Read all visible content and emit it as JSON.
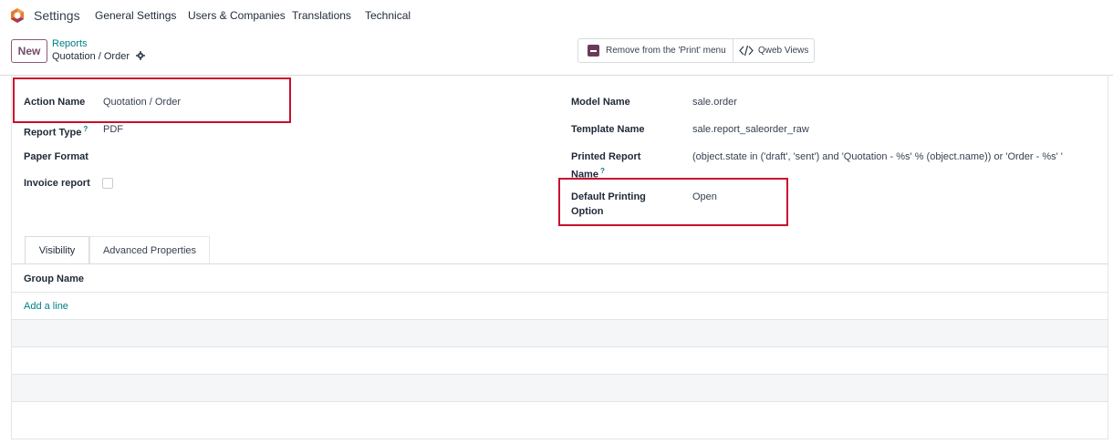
{
  "app": {
    "name": "Settings"
  },
  "navbar": {
    "menu": [
      "General Settings",
      "Users & Companies",
      "Translations",
      "Technical"
    ]
  },
  "control": {
    "new_label": "New",
    "breadcrumb_parent": "Reports",
    "breadcrumb_current": "Quotation / Order",
    "remove_print_label": "Remove from the 'Print' menu",
    "qweb_views_label": "Qweb Views"
  },
  "form": {
    "action_name_label": "Action Name",
    "action_name_value": "Quotation / Order",
    "report_type_label": "Report Type",
    "report_type_help": "?",
    "report_type_value": "PDF",
    "paper_format_label": "Paper Format",
    "invoice_report_label": "Invoice report",
    "invoice_report_checked": false,
    "model_name_label": "Model Name",
    "model_name_value": "sale.order",
    "template_name_label": "Template Name",
    "template_name_value": "sale.report_saleorder_raw",
    "printed_report_label_1": "Printed Report",
    "printed_report_label_2": "Name",
    "printed_report_help": "?",
    "printed_report_value": "(object.state in ('draft', 'sent') and 'Quotation - %s' % (object.name)) or 'Order - %s' '",
    "default_printing_label_1": "Default Printing",
    "default_printing_label_2": "Option",
    "default_printing_value": "Open"
  },
  "tabs": [
    "Visibility",
    "Advanced Properties"
  ],
  "grid": {
    "header": "Group Name",
    "add_line": "Add a line"
  },
  "colors": {
    "brand": "#714B67",
    "link": "#017e84",
    "highlight": "#c8102e"
  }
}
